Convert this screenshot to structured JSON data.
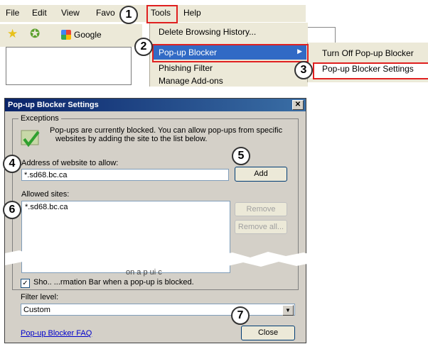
{
  "menubar": {
    "items": [
      "File",
      "Edit",
      "View",
      "Favo",
      "Tools",
      "Help"
    ]
  },
  "toolbar": {
    "google_label": "Google"
  },
  "tools_menu": {
    "items": [
      "Delete Browsing History...",
      "Pop-up Blocker",
      "Phishing Filter",
      "Manage Add-ons"
    ]
  },
  "popup_submenu": {
    "items": [
      "Turn Off Pop-up Blocker",
      "Pop-up Blocker Settings"
    ]
  },
  "callouts": [
    "1",
    "2",
    "3",
    "4",
    "5",
    "6",
    "7"
  ],
  "dialog": {
    "title": "Pop-up Blocker Settings",
    "close_glyph": "✕",
    "exceptions_label": "Exceptions",
    "info_line1": "Pop-ups are currently blocked.  You can allow pop-ups from specific",
    "info_line2": "websites by adding the site to the list below.",
    "address_label": "Address of website to allow:",
    "address_value": "*.sd68.bc.ca",
    "add_button": "Add",
    "allowed_label": "Allowed sites:",
    "allowed_sites": [
      "*.sd68.bc.ca"
    ],
    "remove_button": "Remove",
    "remove_all_button": "Remove all...",
    "partial_text": "on a  p     ui  c",
    "info_bar_checkbox": "Sho.. ...rmation Bar when a pop-up is blocked.",
    "info_bar_checked": "✓",
    "filter_label": "Filter level:",
    "filter_value": "Custom",
    "faq_link": "Pop-up Blocker FAQ",
    "close_button": "Close"
  },
  "colors": {
    "highlight": "#316ac5",
    "callout_box": "#e02020",
    "dialog_bg": "#d4d0c8"
  }
}
